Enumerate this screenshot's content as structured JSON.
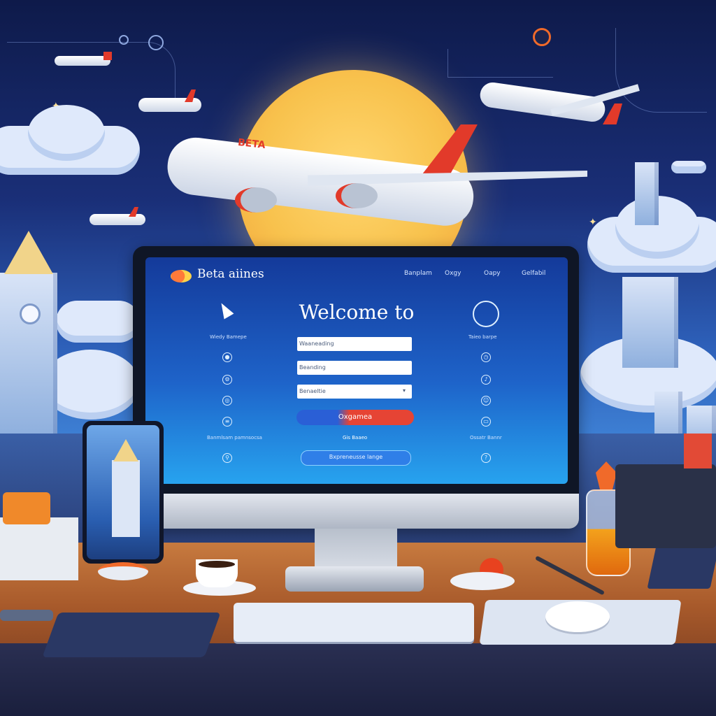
{
  "screen": {
    "brand": "Beta aiines",
    "nav": [
      "Banplam",
      "Oxgy",
      "Oapy",
      "Gelfabil"
    ],
    "welcome": "Welcome to",
    "fields": [
      "Waaneading",
      "Beanding",
      "Benaeltie"
    ],
    "select_arrow": "▾",
    "primary_button": "Oxgamea",
    "secondary_button": "Bxpreneusse lange",
    "center_link": "Gis Baaeo",
    "left_panel": {
      "heading": "Wiedy Bamepe",
      "footer": "Banmlsam pamnsocsa"
    },
    "right_panel": {
      "heading": "Taieo barpe",
      "footer": "Ossatr Bannr"
    }
  },
  "plane_livery": "BETA",
  "colors": {
    "accent_red": "#e23a2a",
    "sky_dark": "#0e1a4a",
    "screen_blue": "#1e63c9"
  }
}
